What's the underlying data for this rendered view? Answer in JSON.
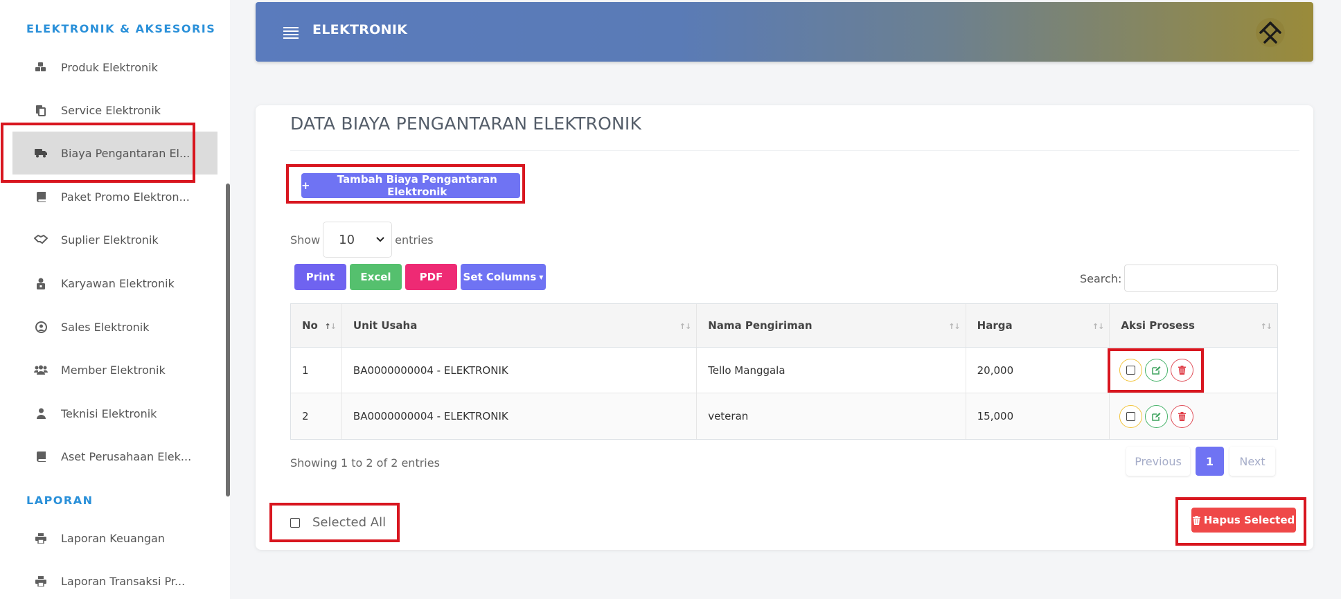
{
  "sidebar": {
    "section_elektronik": "ELEKTRONIK & AKSESORIS",
    "items": [
      {
        "label": "Produk Elektronik",
        "icon": "cubes-icon"
      },
      {
        "label": "Service Elektronik",
        "icon": "copy-icon"
      },
      {
        "label": "Biaya Pengantaran El...",
        "icon": "truck-icon"
      },
      {
        "label": "Paket Promo Elektron...",
        "icon": "book-icon"
      },
      {
        "label": "Suplier Elektronik",
        "icon": "handshake-icon"
      },
      {
        "label": "Karyawan Elektronik",
        "icon": "user-lock-icon"
      },
      {
        "label": "Sales Elektronik",
        "icon": "user-circle-icon"
      },
      {
        "label": "Member Elektronik",
        "icon": "users-icon"
      },
      {
        "label": "Teknisi Elektronik",
        "icon": "user-icon"
      },
      {
        "label": "Aset Perusahaan Elek...",
        "icon": "book-icon"
      }
    ],
    "section_laporan": "LAPORAN",
    "laporan_items": [
      {
        "label": "Laporan Keuangan",
        "icon": "print-icon"
      },
      {
        "label": "Laporan Transaksi Pr...",
        "icon": "print-icon"
      }
    ]
  },
  "header": {
    "title": "ELEKTRONIK"
  },
  "main": {
    "title": "DATA BIAYA PENGANTARAN ELEKTRONIK",
    "add_button": "Tambah Biaya Pengantaran Elektronik",
    "show_label": "Show",
    "entries_label": "entries",
    "page_size": "10",
    "buttons": {
      "print": "Print",
      "excel": "Excel",
      "pdf": "PDF",
      "set_columns": "Set Columns"
    },
    "search_label": "Search:",
    "search_value": "",
    "table": {
      "headers": [
        "No",
        "Unit Usaha",
        "Nama Pengiriman",
        "Harga",
        "Aksi Prosess"
      ],
      "rows": [
        [
          "1",
          "BA0000000004 - ELEKTRONIK",
          "Tello Manggala",
          "20,000"
        ],
        [
          "2",
          "BA0000000004 - ELEKTRONIK",
          "veteran",
          "15,000"
        ]
      ]
    },
    "info": "Showing 1 to 2 of 2 entries",
    "pagination": {
      "previous": "Previous",
      "current": "1",
      "next": "Next"
    },
    "selected_all": "Selected All",
    "hapus_selected": "Hapus Selected"
  },
  "colors": {
    "primary": "#6f73f3",
    "success": "#55c06e",
    "danger": "#ee2a74",
    "delete": "#ef4848",
    "sidebar_section": "#2a90d9",
    "highlight": "#d8161f"
  }
}
